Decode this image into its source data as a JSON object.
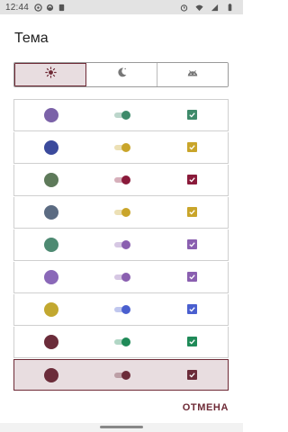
{
  "status_bar": {
    "time": "12:44"
  },
  "dialog": {
    "title": "Тема",
    "modes": [
      {
        "icon": "sun-icon",
        "active": true
      },
      {
        "icon": "moon-icon",
        "active": false
      },
      {
        "icon": "android-icon",
        "active": false
      }
    ],
    "colors": [
      {
        "color": "#7b62a8",
        "accent": "#3e8a6a",
        "selected": false
      },
      {
        "color": "#3b4a9c",
        "accent": "#c9a52a",
        "selected": false
      },
      {
        "color": "#5e7a5a",
        "accent": "#8a1a3a",
        "selected": false
      },
      {
        "color": "#5b6b82",
        "accent": "#c9a52a",
        "selected": false
      },
      {
        "color": "#4e8a72",
        "accent": "#8a5fb0",
        "selected": false
      },
      {
        "color": "#8a68b8",
        "accent": "#8a5fb0",
        "selected": false
      },
      {
        "color": "#c2a830",
        "accent": "#4a5fcf",
        "selected": false
      },
      {
        "color": "#6b2c3a",
        "accent": "#1f8a58",
        "selected": false
      },
      {
        "color": "#6b2c3a",
        "accent": "#6b2c3a",
        "selected": true
      }
    ],
    "cancel_label": "ОТМЕНА"
  }
}
